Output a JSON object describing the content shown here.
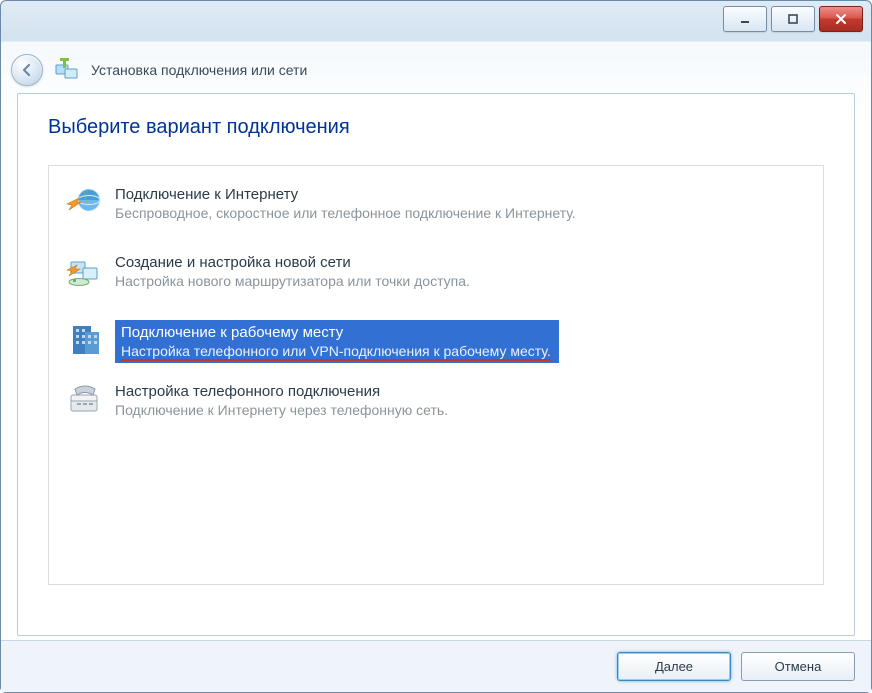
{
  "window": {
    "title": "Установка подключения или сети"
  },
  "page": {
    "heading": "Выберите вариант подключения"
  },
  "options": [
    {
      "title": "Подключение к Интернету",
      "desc": "Беспроводное, скоростное или телефонное подключение к Интернету."
    },
    {
      "title": "Создание и настройка новой сети",
      "desc": "Настройка нового маршрутизатора или точки доступа."
    },
    {
      "title": "Подключение к рабочему месту",
      "desc": "Настройка телефонного или VPN-подключения к рабочему месту."
    },
    {
      "title": "Настройка телефонного подключения",
      "desc": "Подключение к Интернету через телефонную сеть."
    }
  ],
  "buttons": {
    "next": "Далее",
    "cancel": "Отмена"
  }
}
